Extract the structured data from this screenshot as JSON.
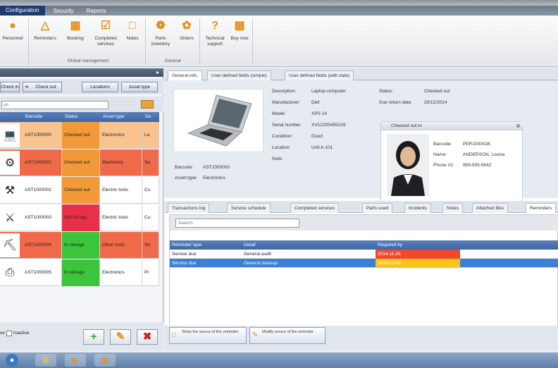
{
  "menu": [
    "Configuration",
    "Security",
    "Reports"
  ],
  "ribbon": {
    "buttons": [
      {
        "label": "Personnel",
        "icon": "person-icon"
      },
      {
        "label": "Reminders",
        "icon": "warning-icon"
      },
      {
        "label": "Booking",
        "icon": "calendar-icon"
      },
      {
        "label": "Completed services",
        "icon": "checklist-icon"
      },
      {
        "label": "Notes",
        "icon": "note-icon"
      },
      {
        "label": "Parts inventory",
        "icon": "parts-icon"
      },
      {
        "label": "Orders",
        "icon": "orders-icon"
      },
      {
        "label": "Technical support",
        "icon": "question-icon"
      },
      {
        "label": "Buy now",
        "icon": "cart-icon"
      }
    ],
    "groups": [
      "Global management",
      "General"
    ]
  },
  "left": {
    "toolbar": {
      "checkin": "Check in",
      "checkout": "Check out",
      "locations": "Locations",
      "asset_type": "Asset type"
    },
    "search_placeholder": "ch",
    "columns": [
      "Barcode",
      "Status",
      "Asset type",
      "De"
    ],
    "rows": [
      {
        "barcode": "AST1000000",
        "status": "Checked out",
        "type": "Electronics",
        "desc": "La",
        "row_color": "#f8c38f",
        "status_color": "#f29a3a",
        "icon": "laptop-icon"
      },
      {
        "barcode": "AST1000001",
        "status": "Checked out",
        "type": "Machinery",
        "desc": "Sa",
        "row_color": "#f06a4a",
        "status_color": "#f29a3a",
        "icon": "machine-icon"
      },
      {
        "barcode": "AST1000002",
        "status": "Checked out",
        "type": "Electric tools",
        "desc": "Cu",
        "row_color": "#ffffff",
        "status_color": "#f29a3a",
        "icon": "drill-icon"
      },
      {
        "barcode": "AST1000003",
        "status": "Out for rep.",
        "type": "Electric tools",
        "desc": "Cu",
        "row_color": "#ffffff",
        "status_color": "#e8304a",
        "icon": "saw-icon"
      },
      {
        "barcode": "AST1000004",
        "status": "In storage",
        "type": "Other tools",
        "desc": "Sh",
        "row_color": "#f06a4a",
        "status_color": "#3cc43c",
        "icon": "shovel-icon"
      },
      {
        "barcode": "AST1000005",
        "status": "In storage",
        "type": "Electronics",
        "desc": "Pr",
        "row_color": "#ffffff",
        "status_color": "#3cc43c",
        "icon": "printer-icon"
      }
    ],
    "inactive_label": "Inactive",
    "active_label": "ve"
  },
  "right": {
    "tabs_top": [
      "General info.",
      "User defined fields (simple)",
      "User defined fields (with date)"
    ],
    "info": {
      "description_label": "Description:",
      "description": "Laptop computer",
      "manufacturer_label": "Manufacturer:",
      "manufacturer": "Dell",
      "model_label": "Model:",
      "model": "XPS 14",
      "serial_label": "Serial number:",
      "serial": "XV12205455229",
      "condition_label": "Condition:",
      "condition": "Good",
      "location_label": "Location:",
      "location": "Unit A-101",
      "note_label": "Note:",
      "status_label": "Status:",
      "status": "Checked out",
      "due_label": "Due return date:",
      "due": "20/12/2014",
      "barcode_label": "Barcode:",
      "barcode": "AST1000000",
      "asset_type_label": "Asset type:",
      "asset_type": "Electronics"
    },
    "checked_out_to": {
      "title": "Checked out to",
      "barcode_label": "Barcode:",
      "barcode": "PER1000034",
      "name_label": "Name:",
      "name": "ANDERSON, Louise",
      "phone_label": "Phone #1:",
      "phone": "959-555-6542"
    },
    "tabs_bottom": [
      "Transactions log",
      "Service schedule",
      "Completed services",
      "Parts used",
      "Incidents",
      "Notes",
      "Attached files",
      "Reminders"
    ],
    "reminders": {
      "search_placeholder": "Search",
      "columns": [
        "Reminder type",
        "Detail",
        "Required by"
      ],
      "rows": [
        {
          "type": "Service due",
          "detail": "General audit",
          "date": "2014-11-25",
          "date_color": "#f04a2e",
          "selected": false
        },
        {
          "type": "Service due",
          "detail": "General cleanup",
          "date": "2014-12-05",
          "date_color": "#f7c41a",
          "selected": true
        }
      ]
    },
    "bottom_buttons": [
      "Show the source of this reminder",
      "Modify source of the reminder"
    ]
  },
  "colors": {
    "accent": "#3e67a8",
    "selected": "#3d7fd6"
  }
}
